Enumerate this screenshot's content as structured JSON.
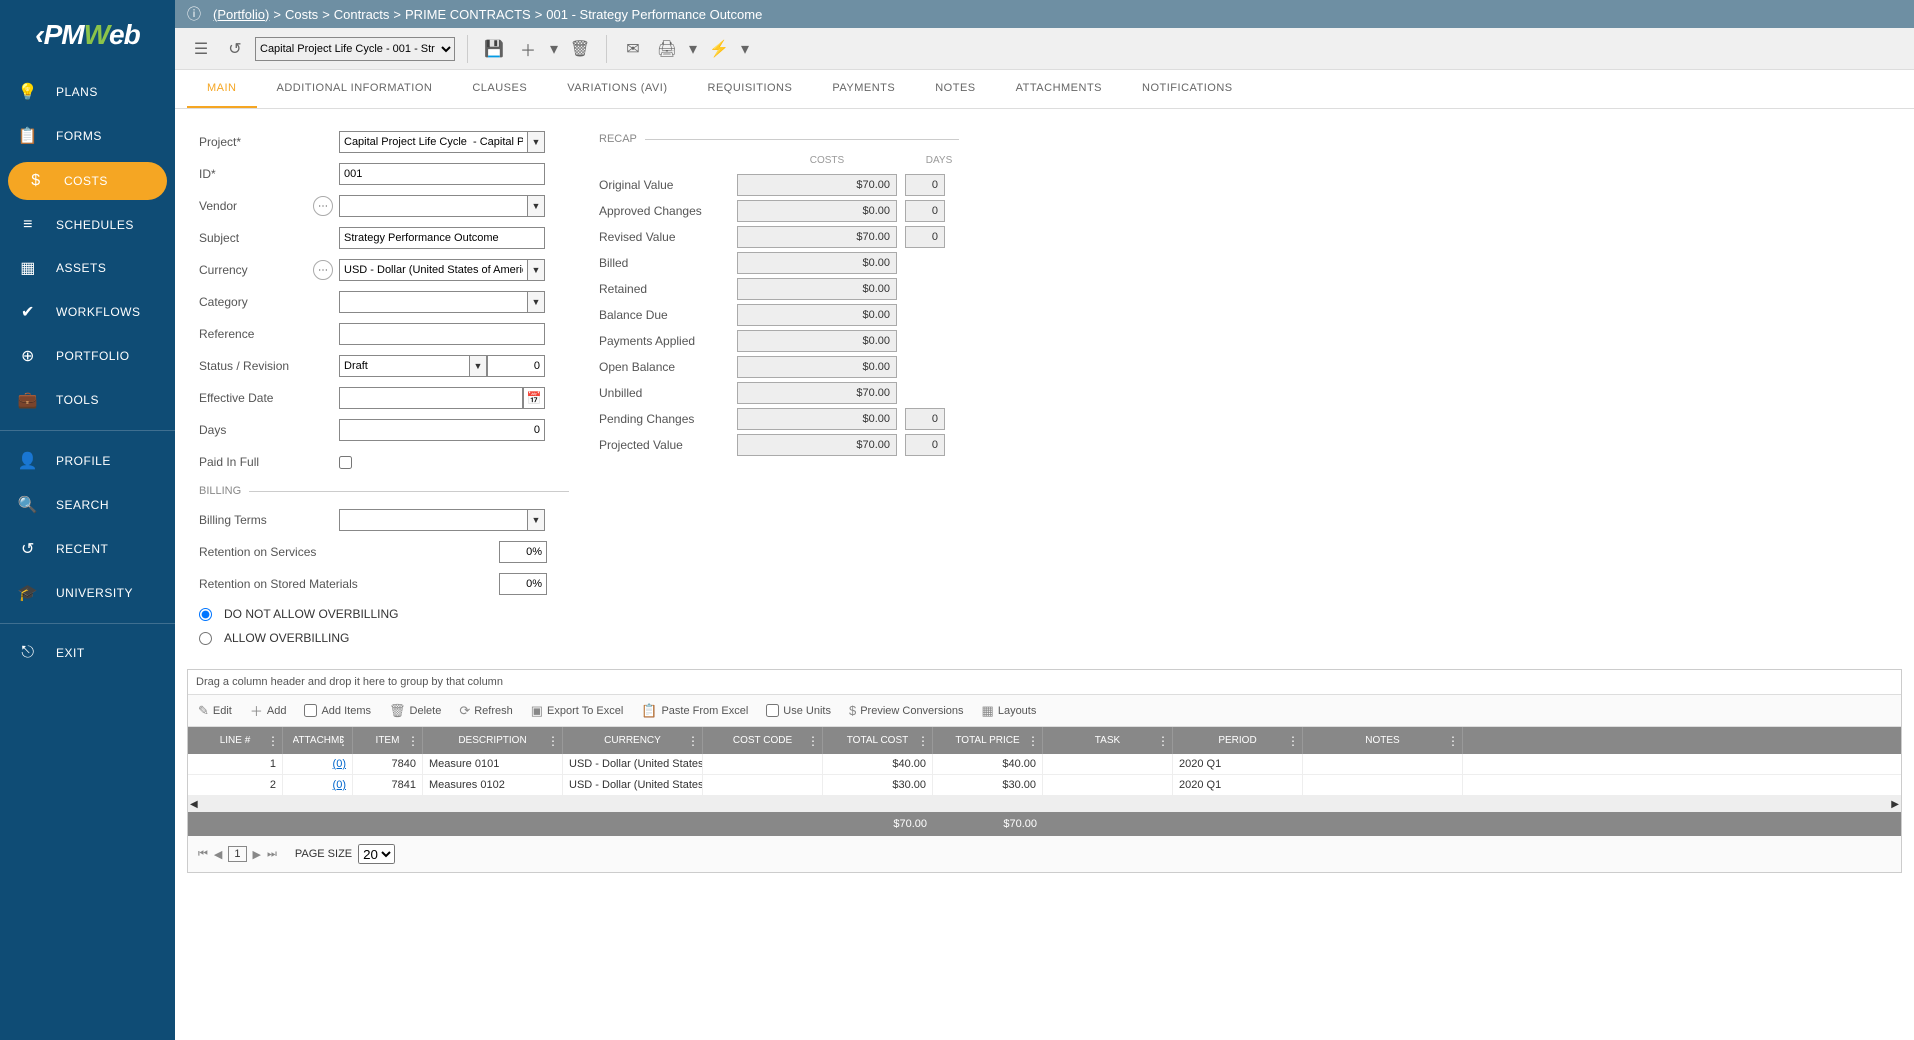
{
  "logo": {
    "pre": "‹PM",
    "mid": "W",
    "post": "eb"
  },
  "sidebar": {
    "items": [
      {
        "icon": "💡",
        "label": "PLANS"
      },
      {
        "icon": "📋",
        "label": "FORMS"
      },
      {
        "icon": "$",
        "label": "COSTS"
      },
      {
        "icon": "≡",
        "label": "SCHEDULES"
      },
      {
        "icon": "▦",
        "label": "ASSETS"
      },
      {
        "icon": "✔",
        "label": "WORKFLOWS"
      },
      {
        "icon": "⊕",
        "label": "PORTFOLIO"
      },
      {
        "icon": "💼",
        "label": "TOOLS"
      }
    ],
    "items2": [
      {
        "icon": "👤",
        "label": "PROFILE"
      },
      {
        "icon": "🔍",
        "label": "SEARCH"
      },
      {
        "icon": "↺",
        "label": "RECENT"
      },
      {
        "icon": "🎓",
        "label": "UNIVERSITY"
      }
    ],
    "items3": [
      {
        "icon": "⎋",
        "label": "EXIT"
      }
    ]
  },
  "breadcrumb": {
    "link": "(Portfolio)",
    "sep": ">",
    "p1": "Costs",
    "p2": "Contracts",
    "p3": "PRIME CONTRACTS",
    "p4": "001 - Strategy Performance Outcome"
  },
  "toolbar": {
    "project_select": "Capital Project Life Cycle  - 001 - Str"
  },
  "tabs": {
    "t0": "MAIN",
    "t1": "ADDITIONAL INFORMATION",
    "t2": "CLAUSES",
    "t3": "VARIATIONS (AVI)",
    "t4": "REQUISITIONS",
    "t5": "PAYMENTS",
    "t6": "NOTES",
    "t7": "ATTACHMENTS",
    "t8": "NOTIFICATIONS"
  },
  "form": {
    "labels": {
      "project": "Project*",
      "id": "ID*",
      "vendor": "Vendor",
      "subject": "Subject",
      "currency": "Currency",
      "category": "Category",
      "reference": "Reference",
      "status": "Status / Revision",
      "effdate": "Effective Date",
      "days": "Days",
      "paidfull": "Paid In Full",
      "billing": "BILLING",
      "billterms": "Billing Terms",
      "retserv": "Retention on Services",
      "retmat": "Retention on Stored Materials",
      "noover": "DO NOT ALLOW OVERBILLING",
      "allowover": "ALLOW OVERBILLING"
    },
    "values": {
      "project": "Capital Project Life Cycle  - Capital P",
      "id": "001",
      "vendor": "",
      "subject": "Strategy Performance Outcome",
      "currency": "USD - Dollar (United States of America)",
      "category": "",
      "reference": "",
      "status": "Draft",
      "revision": "0",
      "effdate": "",
      "days": "0",
      "billterms": "",
      "retserv": "0%",
      "retmat": "0%"
    }
  },
  "recap": {
    "title": "RECAP",
    "hcosts": "COSTS",
    "hdays": "DAYS",
    "rows": [
      {
        "label": "Original Value",
        "cost": "$70.00",
        "days": "0"
      },
      {
        "label": "Approved Changes",
        "cost": "$0.00",
        "days": "0"
      },
      {
        "label": "Revised Value",
        "cost": "$70.00",
        "days": "0"
      },
      {
        "label": "Billed",
        "cost": "$0.00",
        "days": ""
      },
      {
        "label": "Retained",
        "cost": "$0.00",
        "days": ""
      },
      {
        "label": "Balance Due",
        "cost": "$0.00",
        "days": ""
      },
      {
        "label": "Payments Applied",
        "cost": "$0.00",
        "days": ""
      },
      {
        "label": "Open Balance",
        "cost": "$0.00",
        "days": ""
      },
      {
        "label": "Unbilled",
        "cost": "$70.00",
        "days": ""
      },
      {
        "label": "Pending Changes",
        "cost": "$0.00",
        "days": "0"
      },
      {
        "label": "Projected Value",
        "cost": "$70.00",
        "days": "0"
      }
    ]
  },
  "grid": {
    "group_hint": "Drag a column header and drop it here to group by that column",
    "tools": {
      "edit": "Edit",
      "add": "Add",
      "additems": "Add Items",
      "delete": "Delete",
      "refresh": "Refresh",
      "excel": "Export To Excel",
      "paste": "Paste From Excel",
      "units": "Use Units",
      "preview": "Preview Conversions",
      "layouts": "Layouts"
    },
    "headers": {
      "line": "LINE #",
      "att": "ATTACHMENTS",
      "item": "ITEM",
      "desc": "DESCRIPTION",
      "curr": "CURRENCY",
      "code": "COST CODE",
      "tcost": "TOTAL COST",
      "tprice": "TOTAL PRICE",
      "task": "TASK",
      "period": "PERIOD",
      "notes": "NOTES"
    },
    "rows": [
      {
        "line": "1",
        "att": "(0)",
        "item": "7840",
        "desc": "Measure 0101",
        "curr": "USD - Dollar (United States of America)",
        "code": "",
        "tcost": "$40.00",
        "tprice": "$40.00",
        "task": "",
        "period": "2020 Q1",
        "notes": ""
      },
      {
        "line": "2",
        "att": "(0)",
        "item": "7841",
        "desc": "Measures 0102",
        "curr": "USD - Dollar (United States of America)",
        "code": "",
        "tcost": "$30.00",
        "tprice": "$30.00",
        "task": "",
        "period": "2020 Q1",
        "notes": ""
      }
    ],
    "totals": {
      "tcost": "$70.00",
      "tprice": "$70.00"
    },
    "pager": {
      "label": "PAGE SIZE",
      "size": "20",
      "page": "1"
    }
  }
}
